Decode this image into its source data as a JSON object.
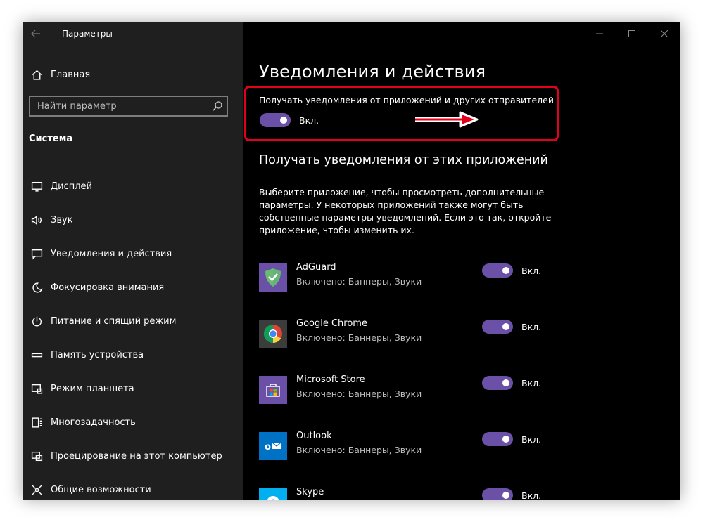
{
  "window": {
    "title": "Параметры"
  },
  "sidebar": {
    "home_label": "Главная",
    "search_placeholder": "Найти параметр",
    "section_title": "Система",
    "items": [
      {
        "label": "Дисплей",
        "icon": "display-icon"
      },
      {
        "label": "Звук",
        "icon": "speaker-icon"
      },
      {
        "label": "Уведомления и действия",
        "icon": "notification-icon"
      },
      {
        "label": "Фокусировка внимания",
        "icon": "moon-icon"
      },
      {
        "label": "Питание и спящий режим",
        "icon": "power-icon"
      },
      {
        "label": "Память устройства",
        "icon": "storage-icon"
      },
      {
        "label": "Режим планшета",
        "icon": "tablet-icon"
      },
      {
        "label": "Многозадачность",
        "icon": "multitasking-icon"
      },
      {
        "label": "Проецирование на этот компьютер",
        "icon": "projection-icon"
      },
      {
        "label": "Общие возможности",
        "icon": "shared-experiences-icon"
      }
    ]
  },
  "main": {
    "title": "Уведомления и действия",
    "master_toggle": {
      "label": "Получать уведомления от приложений и других отправителей",
      "state": "Вкл."
    },
    "apps_section": {
      "title": "Получать уведомления от этих приложений",
      "description": "Выберите приложение, чтобы просмотреть дополнительные параметры. У некоторых приложений также могут быть собственные параметры уведомлений. Если это так, откройте приложение, чтобы изменить их.",
      "apps": [
        {
          "name": "AdGuard",
          "status": "Включено: Баннеры, Звуки",
          "toggle": "Вкл.",
          "icon": "adguard-icon"
        },
        {
          "name": "Google Chrome",
          "status": "Включено: Баннеры, Звуки",
          "toggle": "Вкл.",
          "icon": "chrome-icon"
        },
        {
          "name": "Microsoft Store",
          "status": "Включено: Баннеры, Звуки",
          "toggle": "Вкл.",
          "icon": "microsoft-store-icon"
        },
        {
          "name": "Outlook",
          "status": "Включено: Баннеры, Звуки",
          "toggle": "Вкл.",
          "icon": "outlook-icon"
        },
        {
          "name": "Skype",
          "status": "",
          "toggle": "Вкл.",
          "icon": "skype-icon"
        }
      ]
    }
  },
  "colors": {
    "sidebar_bg": "#1f1f1f",
    "main_bg": "#000000",
    "accent_toggle": "#6a50a7",
    "highlight": "#e3001b"
  }
}
